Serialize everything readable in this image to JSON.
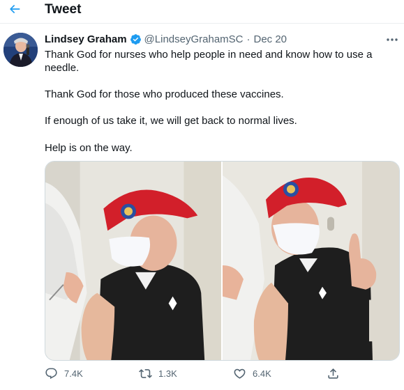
{
  "header": {
    "title": "Tweet",
    "back_icon": "arrow-left-icon",
    "accent_color": "#1d9bf0"
  },
  "tweet": {
    "author_name": "Lindsey Graham",
    "verified": true,
    "handle": "@LindseyGrahamSC",
    "separator": "·",
    "date": "Dec 20",
    "more_icon": "more-dots-icon",
    "paragraphs": [
      "Thank God for nurses who help people in need and know how to use a needle.",
      "Thank God for those who produced these vaccines.",
      "If enough of us take it, we will get back to normal lives.",
      "Help is on the way."
    ],
    "media_count": 2
  },
  "actions": {
    "reply": {
      "icon": "reply-icon",
      "count": "7.4K"
    },
    "retweet": {
      "icon": "retweet-icon",
      "count": "1.3K"
    },
    "like": {
      "icon": "heart-icon",
      "count": "6.4K"
    },
    "share": {
      "icon": "share-icon"
    }
  }
}
